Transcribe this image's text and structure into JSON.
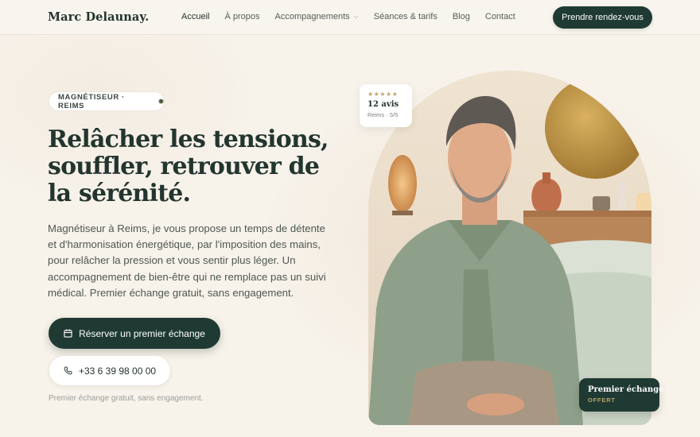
{
  "brand": "Marc Delaunay.",
  "nav": {
    "items": [
      {
        "label": "Accueil"
      },
      {
        "label": "À propos"
      },
      {
        "label": "Accompagnements"
      },
      {
        "label": "Séances & tarifs"
      },
      {
        "label": "Blog"
      },
      {
        "label": "Contact"
      }
    ],
    "cta": "Prendre rendez-vous"
  },
  "hero": {
    "badge": "MAGNÉTISEUR · REIMS",
    "headline": "Relâcher les tensions, souffler, retrouver de la sérénité.",
    "paragraph": "Magnétiseur à Reims, je vous propose un temps de détente et d'harmonisation énergétique, par l'imposition des mains, pour relâcher la pression et vous sentir plus léger. Un accompagnement de bien-être qui ne remplace pas un suivi médical. Premier échange gratuit, sans engagement.",
    "primary_button": "Réserver un premier échange",
    "phone": "+33 6 39 98 00 00",
    "note": "Premier échange gratuit, sans engagement."
  },
  "rating": {
    "stars": "★★★★★",
    "count": "12 avis",
    "meta": "Reims · 5/5"
  },
  "offer": {
    "title": "Premier échange",
    "subtitle": "OFFERT"
  },
  "icons": {
    "calendar": "calendar-icon",
    "phone": "phone-icon",
    "chevron": "chevron-down-icon"
  },
  "colors": {
    "accent": "#1f3a33",
    "background": "#f7f2ea",
    "gold": "#bfa46a"
  }
}
